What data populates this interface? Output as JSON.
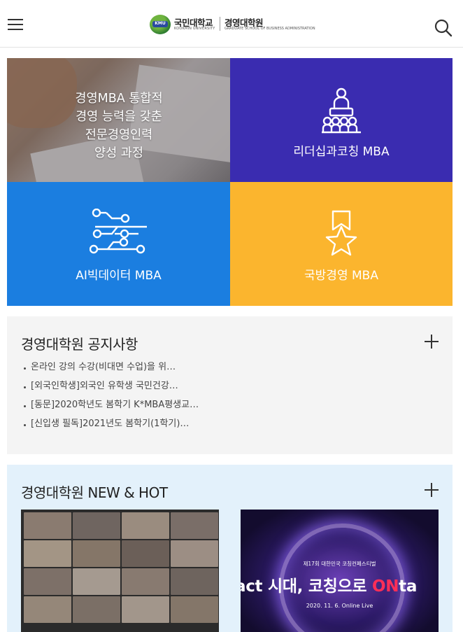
{
  "header": {
    "logo": {
      "emblem": "KMU",
      "university": "국민대학교",
      "university_en": "KOOKMIN UNIVERSITY",
      "school": "경영대학원",
      "school_en": "GRADUATE SCHOOL OF BUSINESS ADMINISTRATION"
    },
    "menu_icon": "hamburger-icon",
    "search_icon": "search-icon"
  },
  "tiles": [
    {
      "lines": [
        "경영MBA 통합적",
        "경영 능력을 갖춘",
        "전문경영인력",
        "양성 과정"
      ],
      "color": "#a08a7a"
    },
    {
      "label": "리더십과코칭 MBA",
      "icon": "leadership-icon",
      "color": "#3a2cb0"
    },
    {
      "label": "AI빅데이터 MBA",
      "icon": "data-network-icon",
      "color": "#1b7ee0"
    },
    {
      "label": "국방경영 MBA",
      "icon": "star-medal-icon",
      "color": "#fbb52e"
    }
  ],
  "notice": {
    "title": "경영대학원 공지사항",
    "more_icon": "plus-icon",
    "items": [
      "온라인 강의 수강(비대면 수업)을 위…",
      "[외국인학생]외국인 유학생 국민건강…",
      "[동문]2020학년도 봄학기 K*MBA평생교…",
      "[신입생 필독]2021년도 봄학기(1학기)…"
    ]
  },
  "newhot": {
    "title": "경영대학원 NEW & HOT",
    "more_icon": "plus-icon",
    "card2": {
      "subtitle": "제17회 대한민국 코칭컨페스티벌",
      "headline_main": "act 시대, 코칭으로 ",
      "headline_accent": "ON",
      "headline_tail": "ta",
      "date": "2020. 11. 6. Online Live"
    }
  }
}
